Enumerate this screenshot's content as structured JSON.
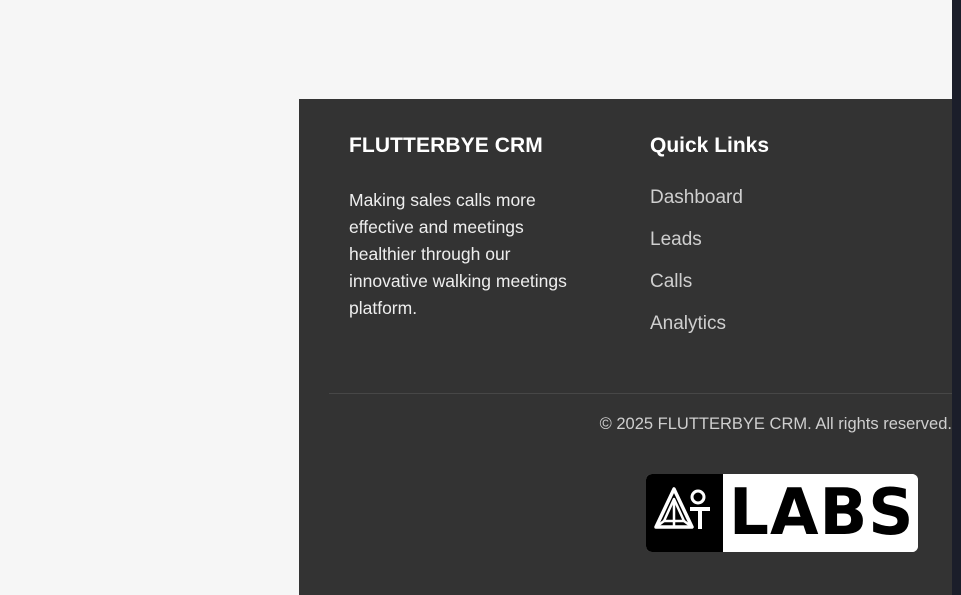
{
  "footer": {
    "brand": {
      "title": "FLUTTERBYE CRM",
      "description": "Making sales calls more effective and meetings healthier through our innovative walking meetings platform."
    },
    "quick_links": {
      "title": "Quick Links",
      "items": [
        {
          "label": "Dashboard"
        },
        {
          "label": "Leads"
        },
        {
          "label": "Calls"
        },
        {
          "label": "Analytics"
        }
      ]
    },
    "copyright": "© 2025 FLUTTERBYE CRM. All rights reserved.",
    "logo": {
      "text": "LABS",
      "mark_letters": "AT",
      "icon": "triangle-logo-icon"
    }
  },
  "colors": {
    "footer_bg": "#333333",
    "page_bg": "#f6f6f6",
    "link": "#cfcfcf",
    "edge_strip": "#1b1e2a"
  }
}
